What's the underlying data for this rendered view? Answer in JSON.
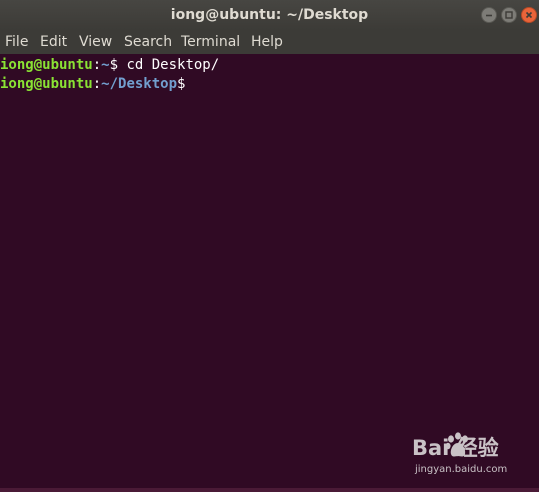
{
  "window": {
    "title": "iong@ubuntu: ~/Desktop"
  },
  "window_controls": {
    "minimize_icon": "minus-icon",
    "maximize_icon": "square-icon",
    "close_icon": "x-icon",
    "close_color": "#e9643a"
  },
  "menubar": {
    "items": [
      "File",
      "Edit",
      "View",
      "Search",
      "Terminal",
      "Help"
    ]
  },
  "terminal": {
    "background": "#300a24",
    "user_color": "#8ae234",
    "path_color": "#729fcf",
    "lines": [
      {
        "user": "iong@ubuntu",
        "sep": ":",
        "path": "~",
        "prompt": "$ ",
        "command": "cd Desktop/"
      },
      {
        "user": "iong@ubuntu",
        "sep": ":",
        "path": "~/Desktop",
        "prompt": "$",
        "command": ""
      }
    ]
  },
  "watermark": {
    "brand": "Bai  经验",
    "url": "jingyan.baidu.com",
    "icon": "baidu-paw-icon"
  }
}
